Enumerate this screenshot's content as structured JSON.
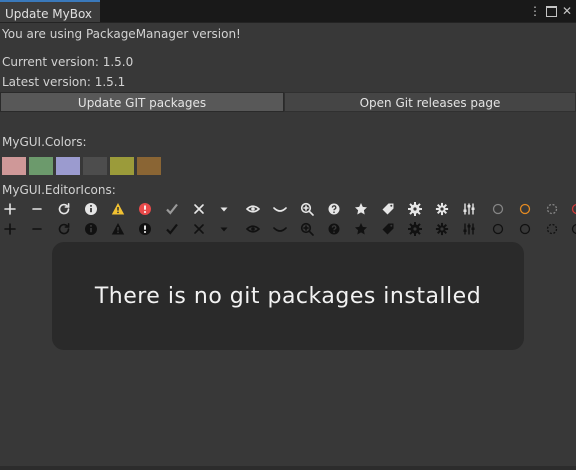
{
  "window": {
    "tab_title": "Update MyBox"
  },
  "info": {
    "using_text": "You are using PackageManager version!",
    "current_version": "Current version: 1.5.0",
    "latest_version": "Latest version: 1.5.1"
  },
  "buttons": {
    "update_git": "Update GIT packages",
    "open_releases": "Open Git releases page"
  },
  "colors_section": {
    "label": "MyGUI.Colors:",
    "swatches": [
      "#cf9898",
      "#6c9a6c",
      "#9b9bcf",
      "#4d4d4d",
      "#9b9b3a",
      "#8a6534"
    ]
  },
  "icons_section": {
    "label": "MyGUI.EditorIcons:",
    "icon_names": [
      "plus-icon",
      "minus-icon",
      "refresh-icon",
      "info-icon",
      "warning-icon",
      "error-icon",
      "checkmark-icon",
      "cross-icon",
      "dropdown-arrow-icon",
      "eye-icon",
      "curve-icon",
      "zoom-icon",
      "help-icon",
      "star-icon",
      "tag-icon",
      "gear-large-icon",
      "gear-small-icon",
      "sliders-icon",
      "circle-icon",
      "circle-orange-icon",
      "circle-dashed-icon",
      "circle-red-icon"
    ],
    "colors": {
      "light": "#e6e6e6",
      "dark": "#111111",
      "warning": "#f2c232",
      "error": "#e84a4a",
      "check_gray": "#9a9a9a",
      "circle_orange": "#e38a22",
      "circle_red": "#d13a3a",
      "circle_gray": "#858585"
    }
  },
  "overlay": {
    "message": "There is no git packages installed"
  }
}
